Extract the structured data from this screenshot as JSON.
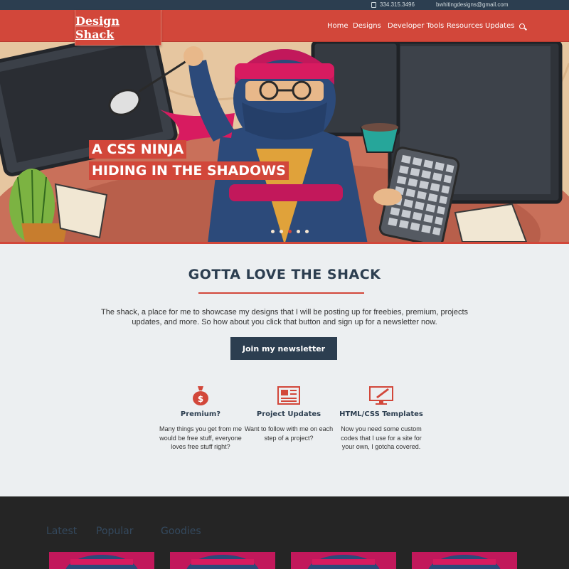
{
  "topbar": {
    "phone": "334.315.3496",
    "email": "bwhitingdesigns@gmail.com"
  },
  "header": {
    "logo": "Design Shack",
    "nav": [
      "Home",
      "Designs",
      "Developer Tools",
      "Resources",
      "Updates"
    ]
  },
  "hero": {
    "title_lines": [
      "A CSS NINJA",
      "HIDING IN THE SHADOWS"
    ],
    "slide_count": 5,
    "active_slide": 3
  },
  "intro": {
    "title": "GOTTA LOVE THE SHACK",
    "text": "The shack, a place for me to showcase my designs that I will be posting up for freebies, premium, projects updates, and more. So how about you click that button and sign up for a newsletter now.",
    "button": "Join my newsletter"
  },
  "features": [
    {
      "title": "Premium?",
      "desc": "Many things you get from me would be free stuff, everyone loves free stuff right?"
    },
    {
      "title": "Project Updates",
      "desc": "Want to follow with me on each step of a project?"
    },
    {
      "title": "HTML/CSS Templates",
      "desc": "Now you need some custom codes that I use for a site for your own, I gotcha covered."
    }
  ],
  "tabs": [
    "Latest",
    "Popular",
    "Goodies"
  ],
  "colors": {
    "accent": "#d2473a",
    "navy": "#2c3e50",
    "dark_bg": "#252525",
    "light_bg": "#eceff1"
  }
}
